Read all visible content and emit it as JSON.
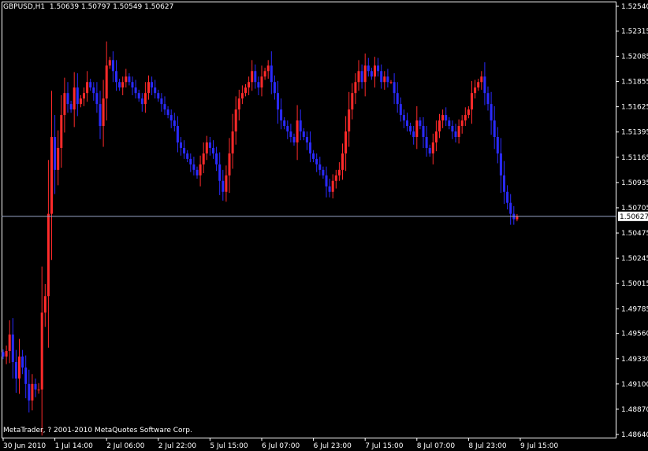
{
  "header": {
    "symbol": "GBPUSD,H1",
    "ohlc": "1.50639 1.50797 1.50549 1.50627"
  },
  "footer": {
    "copyright": "MetaTrader, ? 2001-2010 MetaQuotes Software Corp."
  },
  "colors": {
    "background": "#000000",
    "frame": "#ffffff",
    "bull": "#ff2a2a",
    "bear": "#2a2aff",
    "current_line": "#9aa6c8",
    "price_tag_bg": "#ffffff",
    "price_tag_text": "#000000",
    "axis_text": "#ffffff"
  },
  "chart_data": {
    "type": "candlestick",
    "symbol": "GBPUSD",
    "timeframe": "H1",
    "current_price": 1.50627,
    "ylim": [
      1.4864,
      1.5254
    ],
    "y_ticks": [
      "1.52540",
      "1.52315",
      "1.52085",
      "1.51855",
      "1.51625",
      "1.51395",
      "1.51165",
      "1.50935",
      "1.50705",
      "1.50475",
      "1.50245",
      "1.50015",
      "1.49785",
      "1.49560",
      "1.49330",
      "1.49100",
      "1.48870",
      "1.48640"
    ],
    "x_ticks": [
      "30 Jun 2010",
      "1 Jul 14:00",
      "2 Jul 06:00",
      "2 Jul 22:00",
      "5 Jul 15:00",
      "6 Jul 07:00",
      "6 Jul 23:00",
      "7 Jul 15:00",
      "8 Jul 07:00",
      "8 Jul 23:00",
      "9 Jul 15:00"
    ],
    "x_tick_bar_index": [
      0,
      16,
      32,
      48,
      64,
      80,
      96,
      112,
      128,
      144,
      160
    ],
    "series": [
      {
        "values": [
          1.4935,
          1.494,
          1.4955,
          1.493,
          1.4915,
          1.4935,
          1.4925,
          1.491,
          1.4895,
          1.491,
          1.4905,
          1.4905,
          1.4975,
          1.499,
          1.5065,
          1.5135,
          1.5105,
          1.5125,
          1.5155,
          1.5175,
          1.5165,
          1.516,
          1.518,
          1.5165,
          1.517,
          1.5175,
          1.5185,
          1.518,
          1.5175,
          1.5165,
          1.5145,
          1.517,
          1.52,
          1.5205,
          1.5195,
          1.5185,
          1.518,
          1.5185,
          1.519,
          1.5185,
          1.518,
          1.5175,
          1.517,
          1.5165,
          1.5175,
          1.5185,
          1.518,
          1.5175,
          1.517,
          1.5165,
          1.516,
          1.5155,
          1.515,
          1.5145,
          1.513,
          1.5125,
          1.512,
          1.5115,
          1.511,
          1.5105,
          1.51,
          1.511,
          1.512,
          1.513,
          1.5125,
          1.512,
          1.511,
          1.5095,
          1.5085,
          1.51,
          1.512,
          1.514,
          1.516,
          1.517,
          1.5175,
          1.518,
          1.5185,
          1.5195,
          1.5185,
          1.518,
          1.519,
          1.5195,
          1.52,
          1.5185,
          1.5175,
          1.516,
          1.515,
          1.5145,
          1.514,
          1.5135,
          1.513,
          1.515,
          1.514,
          1.5135,
          1.513,
          1.512,
          1.5115,
          1.511,
          1.5105,
          1.51,
          1.509,
          1.5085,
          1.5095,
          1.51,
          1.5105,
          1.512,
          1.514,
          1.516,
          1.5175,
          1.5185,
          1.5195,
          1.5185,
          1.52,
          1.5195,
          1.519,
          1.52,
          1.5195,
          1.5185,
          1.519,
          1.5185,
          1.5185,
          1.5175,
          1.5165,
          1.5155,
          1.515,
          1.5145,
          1.514,
          1.5135,
          1.515,
          1.5145,
          1.5135,
          1.5125,
          1.512,
          1.513,
          1.514,
          1.515,
          1.5155,
          1.515,
          1.5145,
          1.514,
          1.5135,
          1.5145,
          1.515,
          1.5155,
          1.516,
          1.5175,
          1.518,
          1.5185,
          1.519,
          1.5175,
          1.5165,
          1.515,
          1.5135,
          1.512,
          1.51,
          1.5085,
          1.5075,
          1.5065,
          1.506,
          1.5063
        ]
      }
    ],
    "grid": false,
    "legend": "none"
  }
}
